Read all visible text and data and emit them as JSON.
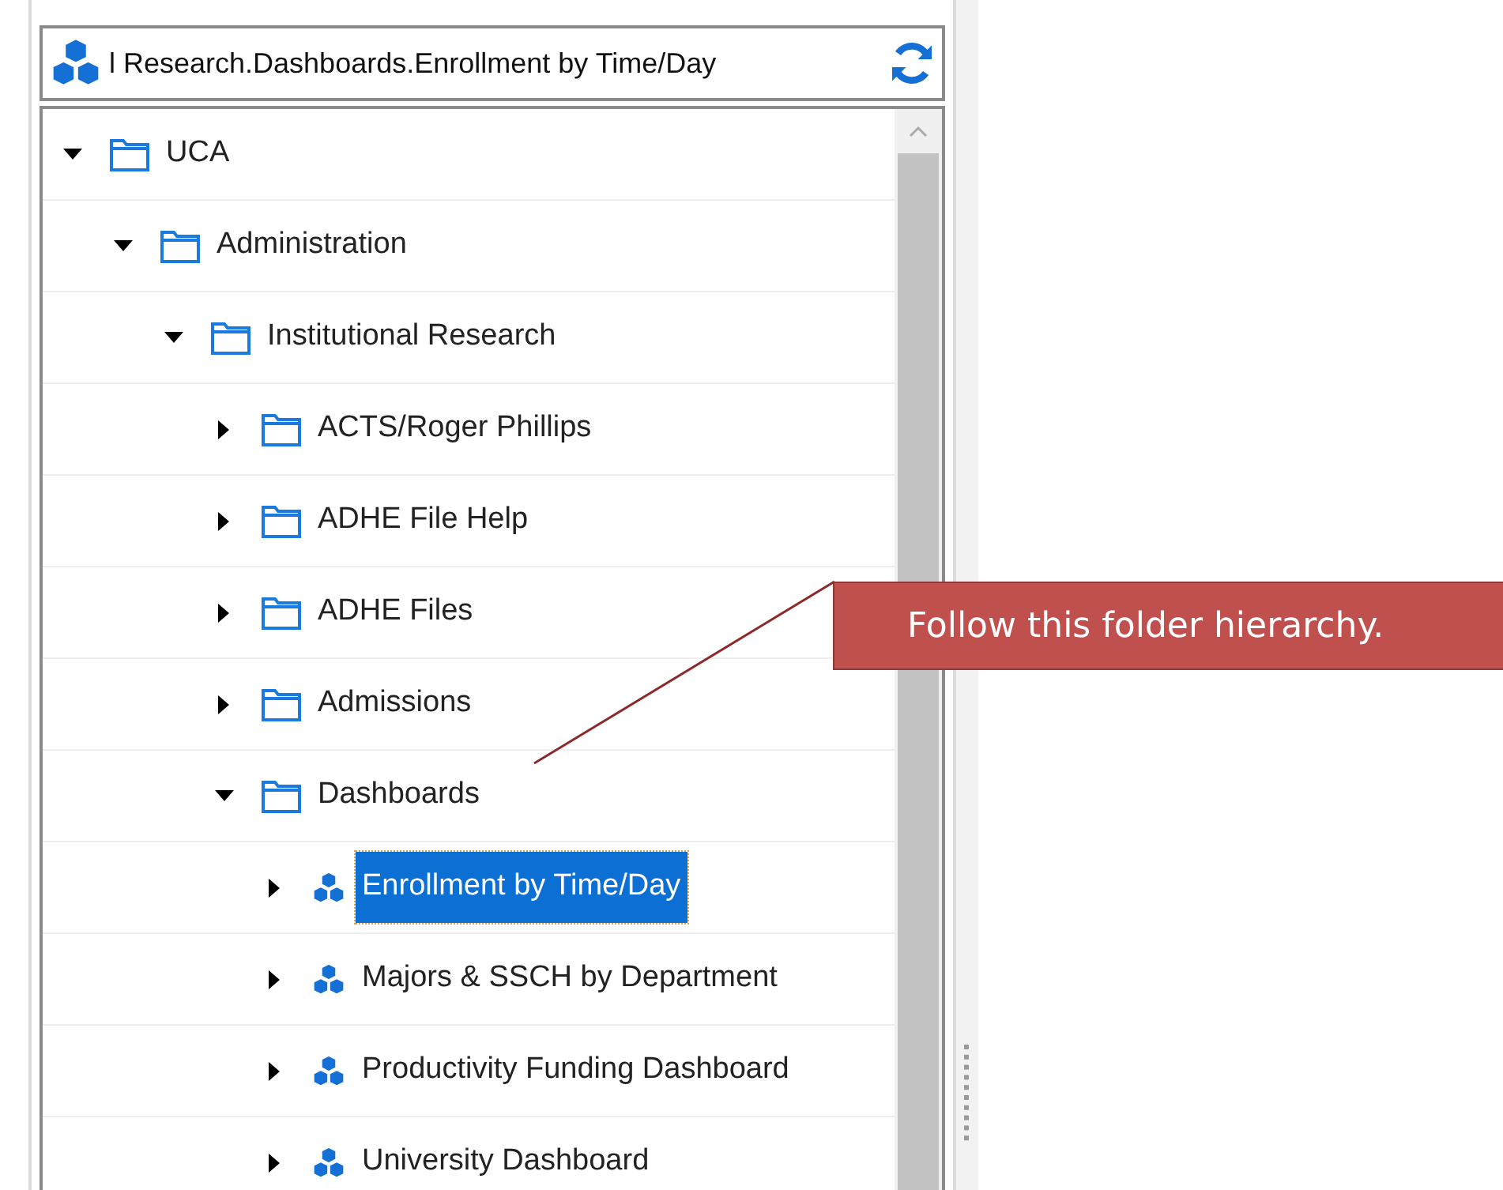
{
  "path_field": {
    "value": "l Research.Dashboards.Enrollment by Time/Day"
  },
  "tree": [
    {
      "label": "UCA",
      "kind": "folder",
      "expanded": true,
      "selected": false,
      "children": [
        {
          "label": "Administration",
          "kind": "folder",
          "expanded": true,
          "selected": false,
          "children": [
            {
              "label": "Institutional Research",
              "kind": "folder",
              "expanded": true,
              "selected": false,
              "children": [
                {
                  "label": "ACTS/Roger Phillips",
                  "kind": "folder",
                  "expanded": false,
                  "selected": false
                },
                {
                  "label": "ADHE File Help",
                  "kind": "folder",
                  "expanded": false,
                  "selected": false
                },
                {
                  "label": "ADHE Files",
                  "kind": "folder",
                  "expanded": false,
                  "selected": false
                },
                {
                  "label": "Admissions",
                  "kind": "folder",
                  "expanded": false,
                  "selected": false
                },
                {
                  "label": "Dashboards",
                  "kind": "folder",
                  "expanded": true,
                  "selected": false,
                  "children": [
                    {
                      "label": "Enrollment by Time/Day",
                      "kind": "cube",
                      "expanded": false,
                      "selected": true
                    },
                    {
                      "label": "Majors & SSCH by Department",
                      "kind": "cube",
                      "expanded": false,
                      "selected": false
                    },
                    {
                      "label": "Productivity Funding Dashboard",
                      "kind": "cube",
                      "expanded": false,
                      "selected": false
                    },
                    {
                      "label": "University Dashboard",
                      "kind": "cube",
                      "expanded": false,
                      "selected": false
                    }
                  ]
                }
              ]
            }
          ]
        }
      ]
    }
  ],
  "callout": {
    "text": "Follow this folder hierarchy."
  }
}
